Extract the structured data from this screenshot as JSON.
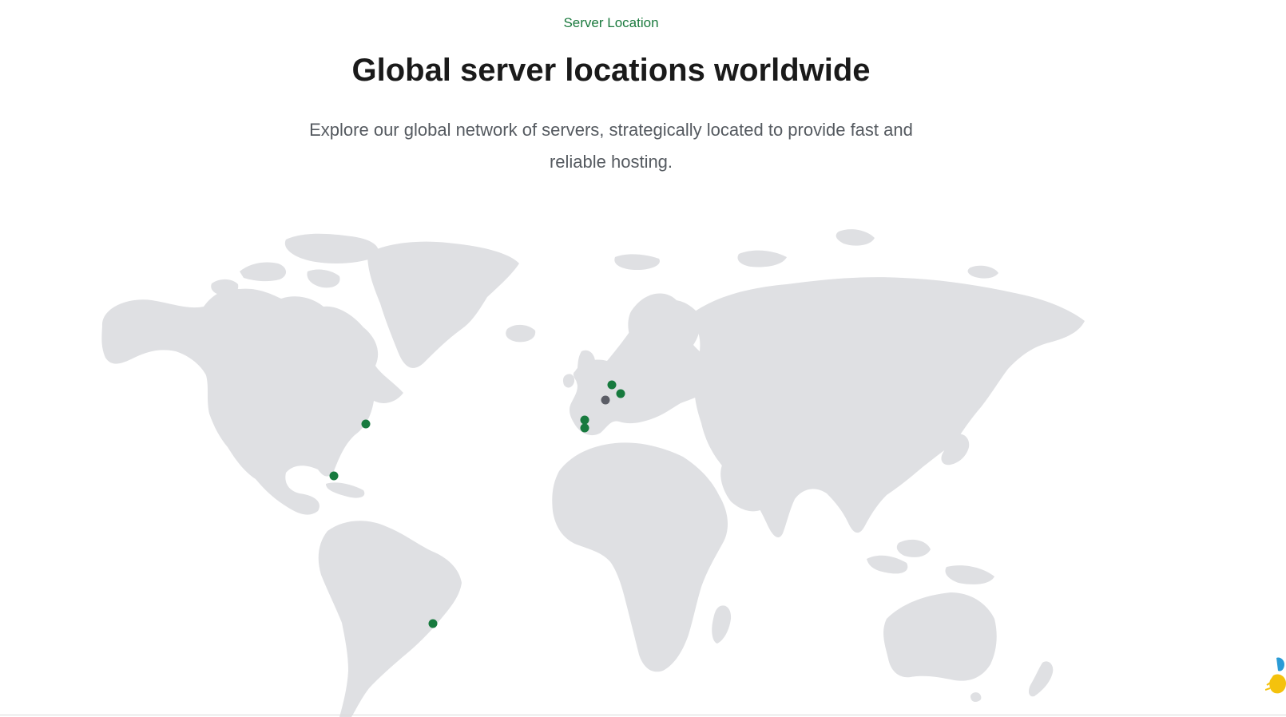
{
  "section": {
    "eyebrow": "Server Location",
    "title": "Global server locations worldwide",
    "subtitle": "Explore our global network of servers, strategically located to provide fast and reliable hosting."
  },
  "colors": {
    "accent": "#1b7a3e",
    "marker_active": "#177a3e",
    "marker_inactive": "#5b5d66",
    "land": "#dfe0e3"
  },
  "markers": [
    {
      "name": "marker-us-east",
      "status": "active"
    },
    {
      "name": "marker-us-southeast",
      "status": "active"
    },
    {
      "name": "marker-brazil",
      "status": "active"
    },
    {
      "name": "marker-uk",
      "status": "active"
    },
    {
      "name": "marker-germany",
      "status": "active"
    },
    {
      "name": "marker-france",
      "status": "inactive"
    },
    {
      "name": "marker-spain-north",
      "status": "active"
    },
    {
      "name": "marker-spain-south",
      "status": "active"
    }
  ]
}
